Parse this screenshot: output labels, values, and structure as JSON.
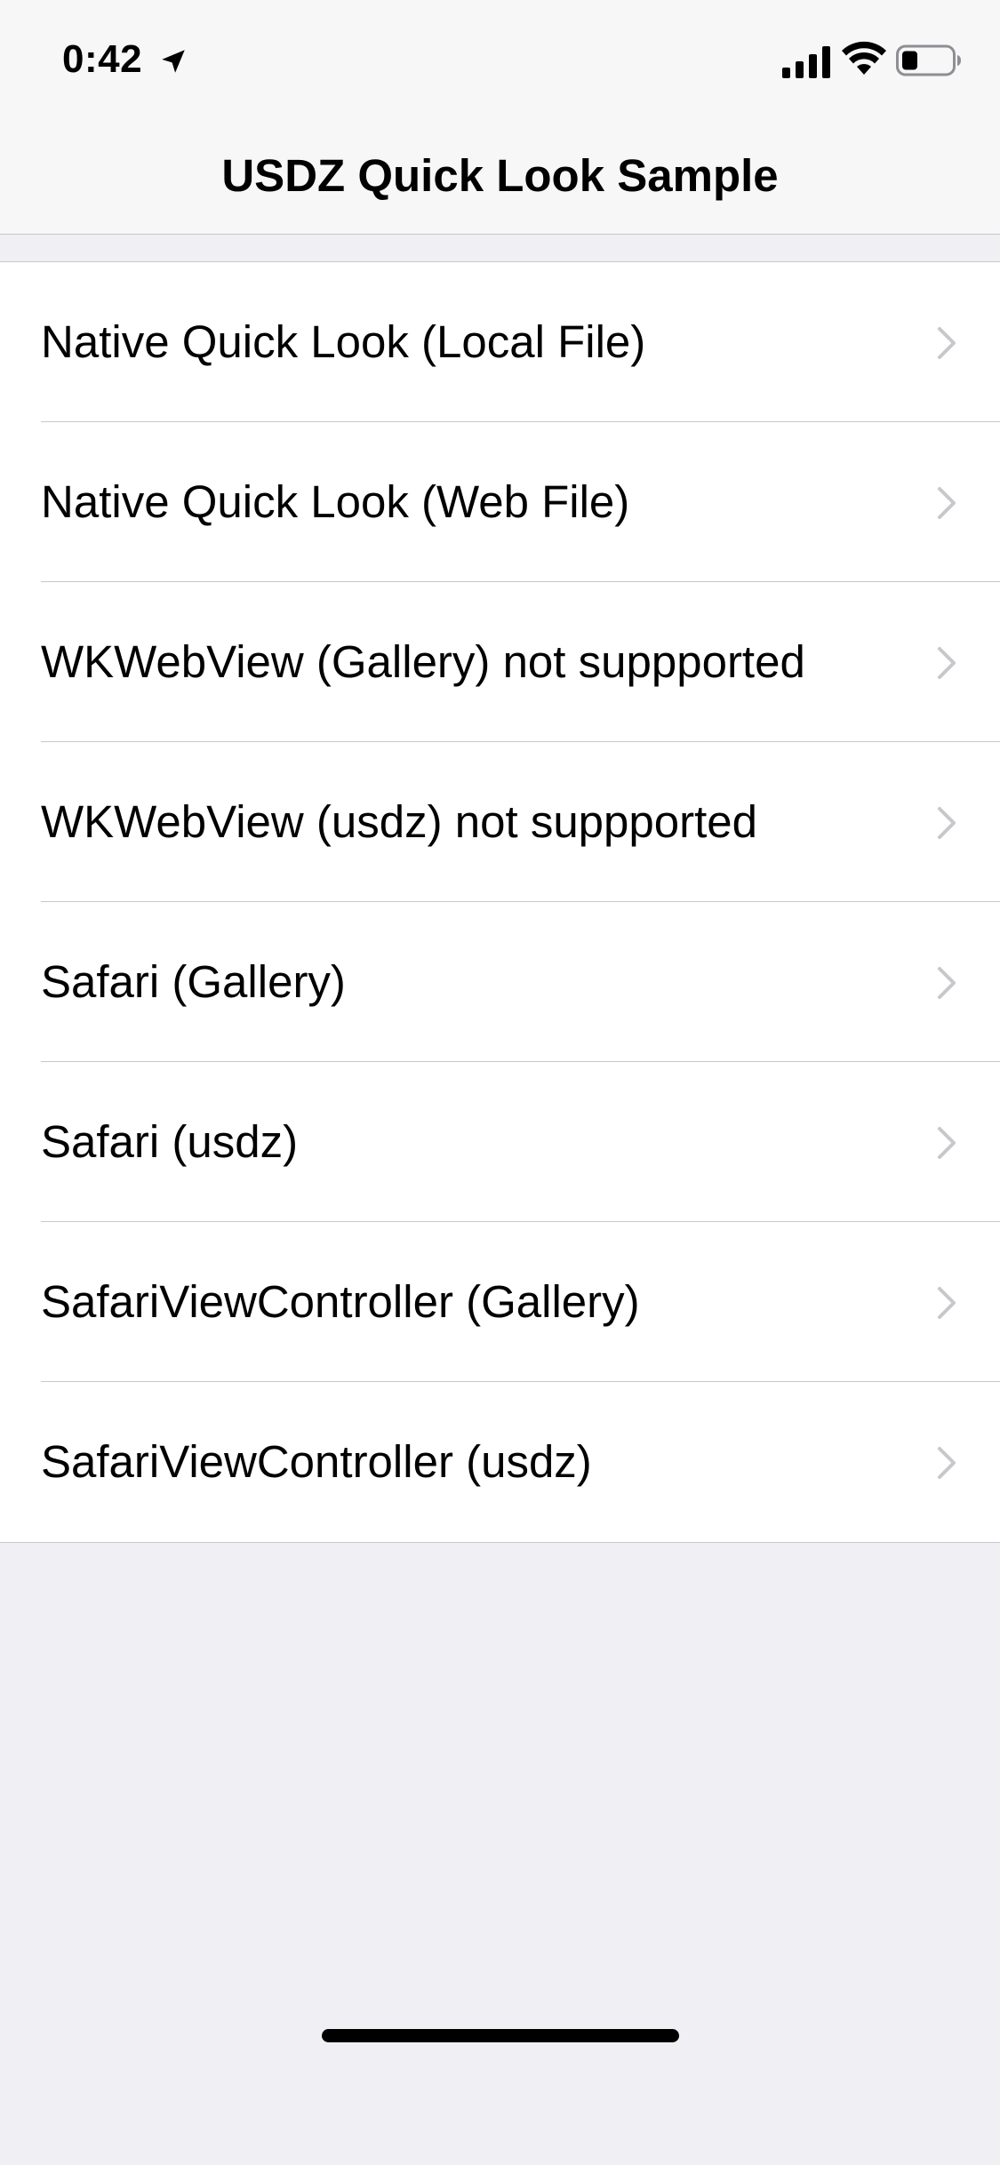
{
  "status_bar": {
    "time": "0:42",
    "location_icon": "location-arrow-icon",
    "signal_icon": "cellular-signal-icon",
    "wifi_icon": "wifi-icon",
    "battery_icon": "battery-icon"
  },
  "nav": {
    "title": "USDZ Quick Look Sample"
  },
  "list": {
    "items": [
      {
        "label": "Native Quick Look (Local File)"
      },
      {
        "label": "Native Quick Look (Web File)"
      },
      {
        "label": "WKWebView (Gallery) not suppported"
      },
      {
        "label": "WKWebView (usdz) not suppported"
      },
      {
        "label": "Safari (Gallery)"
      },
      {
        "label": "Safari (usdz)"
      },
      {
        "label": "SafariViewController (Gallery)"
      },
      {
        "label": "SafariViewController (usdz)"
      }
    ],
    "chevron_icon": "chevron-right-icon"
  },
  "colors": {
    "background": "#efeff4",
    "bar_background": "#f7f7f7",
    "separator": "#c8c7cc",
    "chevron": "#c7c7cc",
    "text": "#000000"
  }
}
